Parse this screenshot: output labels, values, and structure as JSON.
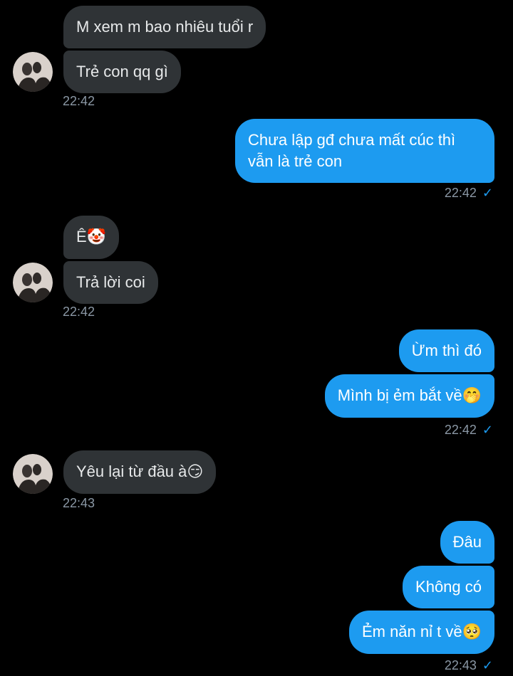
{
  "messages": [
    {
      "text": "M xem m bao nhiêu tuổi r"
    },
    {
      "text": "Trẻ con qq gì"
    },
    {
      "time": "22:42"
    },
    {
      "text": "Chưa lập gđ chưa mất cúc thì vẫn là trẻ con"
    },
    {
      "time": "22:42"
    },
    {
      "text": "Ê",
      "emoji": "🤡"
    },
    {
      "text": "Trả lời coi"
    },
    {
      "time": "22:42"
    },
    {
      "text": "Ừm thì đó"
    },
    {
      "text": "Mình bị ẻm bắt về",
      "emoji": "🤭"
    },
    {
      "time": "22:42"
    },
    {
      "text": "Yêu lại từ đầu à",
      "emoji": "😏"
    },
    {
      "time": "22:43"
    },
    {
      "text": "Đâu"
    },
    {
      "text": "Không có"
    },
    {
      "text": "Ẻm năn nỉ t về",
      "emoji": "🥺"
    },
    {
      "time": "22:43"
    }
  ],
  "colors": {
    "incoming_bubble": "#2f3336",
    "outgoing_bubble": "#1d9bf0",
    "timestamp": "#8b98a5",
    "read_tick": "#1d9bf0"
  },
  "icons": {
    "read_receipt": "check-icon",
    "avatar": "avatar"
  }
}
